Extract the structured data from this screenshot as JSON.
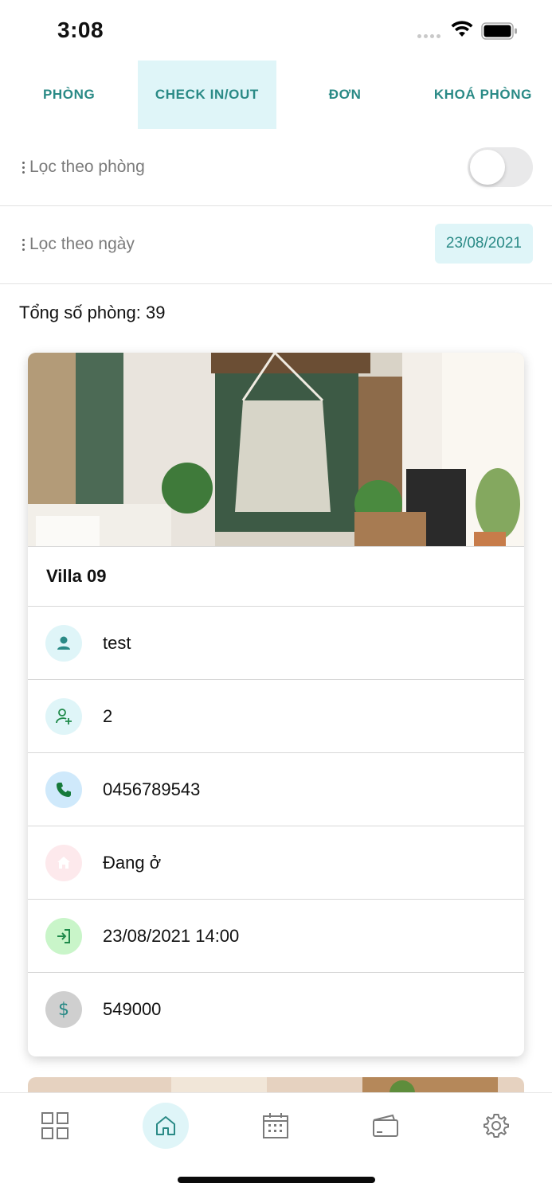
{
  "status_bar": {
    "time": "3:08"
  },
  "tabs": [
    {
      "label": "PHÒNG",
      "active": false
    },
    {
      "label": "CHECK IN/OUT",
      "active": true
    },
    {
      "label": "ĐƠN",
      "active": false
    },
    {
      "label": "KHOÁ PHÒNG",
      "active": false
    }
  ],
  "filters": {
    "room_filter_label": "Lọc theo phòng",
    "room_filter_enabled": false,
    "date_filter_label": "Lọc theo ngày",
    "date_value": "23/08/2021"
  },
  "summary": {
    "total_rooms": "Tổng số phòng: 39"
  },
  "room_card": {
    "name": "Villa 09",
    "rows": [
      {
        "icon": "person-icon",
        "value": "test",
        "icon_bg": "#dff5f8",
        "icon_color": "#2a8a86"
      },
      {
        "icon": "guests-add-icon",
        "value": "2",
        "icon_bg": "#dff5f8",
        "icon_color": "#1f8a4a"
      },
      {
        "icon": "phone-icon",
        "value": "0456789543",
        "icon_bg": "#cfe9fb",
        "icon_color": "#167a3a"
      },
      {
        "icon": "home-icon",
        "value": "Đang ở",
        "icon_bg": "#fde9ec",
        "icon_color": "#ffffff"
      },
      {
        "icon": "login-icon",
        "value": "23/08/2021 14:00",
        "icon_bg": "#c9f5c9",
        "icon_color": "#1f8a4a"
      },
      {
        "icon": "dollar-icon",
        "value": "549000",
        "icon_bg": "#cfcfcf",
        "icon_color": "#2a8a86"
      }
    ]
  },
  "bottom_nav": [
    {
      "icon": "grid-icon",
      "active": false
    },
    {
      "icon": "home-icon",
      "active": true
    },
    {
      "icon": "calendar-icon",
      "active": false
    },
    {
      "icon": "wallet-icon",
      "active": false
    },
    {
      "icon": "gear-icon",
      "active": false
    }
  ],
  "colors": {
    "accent": "#2a8a86",
    "accent_bg": "#dff5f8",
    "divider": "#e2e2e2"
  }
}
